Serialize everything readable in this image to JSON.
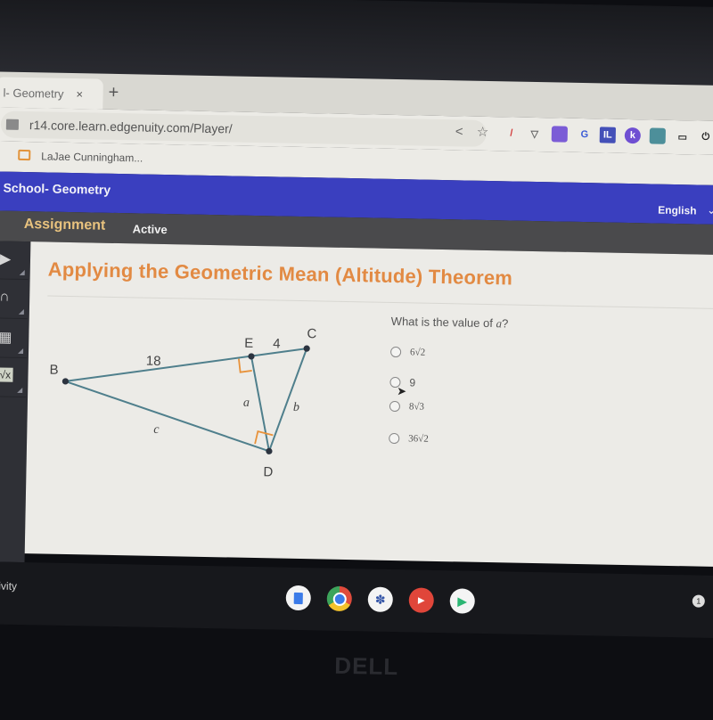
{
  "browser": {
    "tab_title": "l- Geometry",
    "tab_close": "×",
    "new_tab": "+",
    "url": "r14.core.learn.edgenuity.com/Player/",
    "bookmark": "LaJae Cunningham...",
    "toolbar_icons": [
      "share-icon",
      "star-icon",
      "pen-extension-icon",
      "shield-extension-icon",
      "puzzle-extension-icon",
      "loop-extension-icon",
      "il-extension-icon",
      "k-extension-icon",
      "reader-extension-icon",
      "cast-icon",
      "power-icon"
    ],
    "extension_labels": {
      "il": "IL",
      "k": "k"
    }
  },
  "app": {
    "course_title": "School- Geometry",
    "language": "English",
    "language_chevron": "⌄",
    "mode": "Assignment",
    "status": "Active"
  },
  "sidebar": {
    "tools": [
      {
        "name": "forward-tool",
        "glyph": "▶"
      },
      {
        "name": "headphones-tool",
        "glyph": "∩"
      },
      {
        "name": "calculator-tool",
        "glyph": "▦"
      },
      {
        "name": "formula-tool",
        "glyph": "√x"
      }
    ]
  },
  "lesson": {
    "title": "Applying the Geometric Mean (Altitude) Theorem",
    "question_prefix": "What is the value of ",
    "question_var": "a",
    "question_suffix": "?",
    "options": [
      "6√2",
      "9",
      "8√3",
      "36√2"
    ],
    "hovered_option_index": 1
  },
  "diagram": {
    "vertices": {
      "B": "B",
      "C": "C",
      "D": "D",
      "E": "E"
    },
    "segment_labels": {
      "BE": "18",
      "EC": "4",
      "a": "a",
      "b": "b",
      "c": "c"
    },
    "line_color": "#4f7f8c",
    "right_angle_color": "#e8923a"
  },
  "shelf": {
    "activity_label": "ctivity",
    "apps": [
      "docs-app",
      "chrome-app",
      "organizer-app",
      "youtube-app",
      "play-store-app"
    ],
    "notification_count": "1"
  },
  "hardware": {
    "brand": "DELL"
  }
}
